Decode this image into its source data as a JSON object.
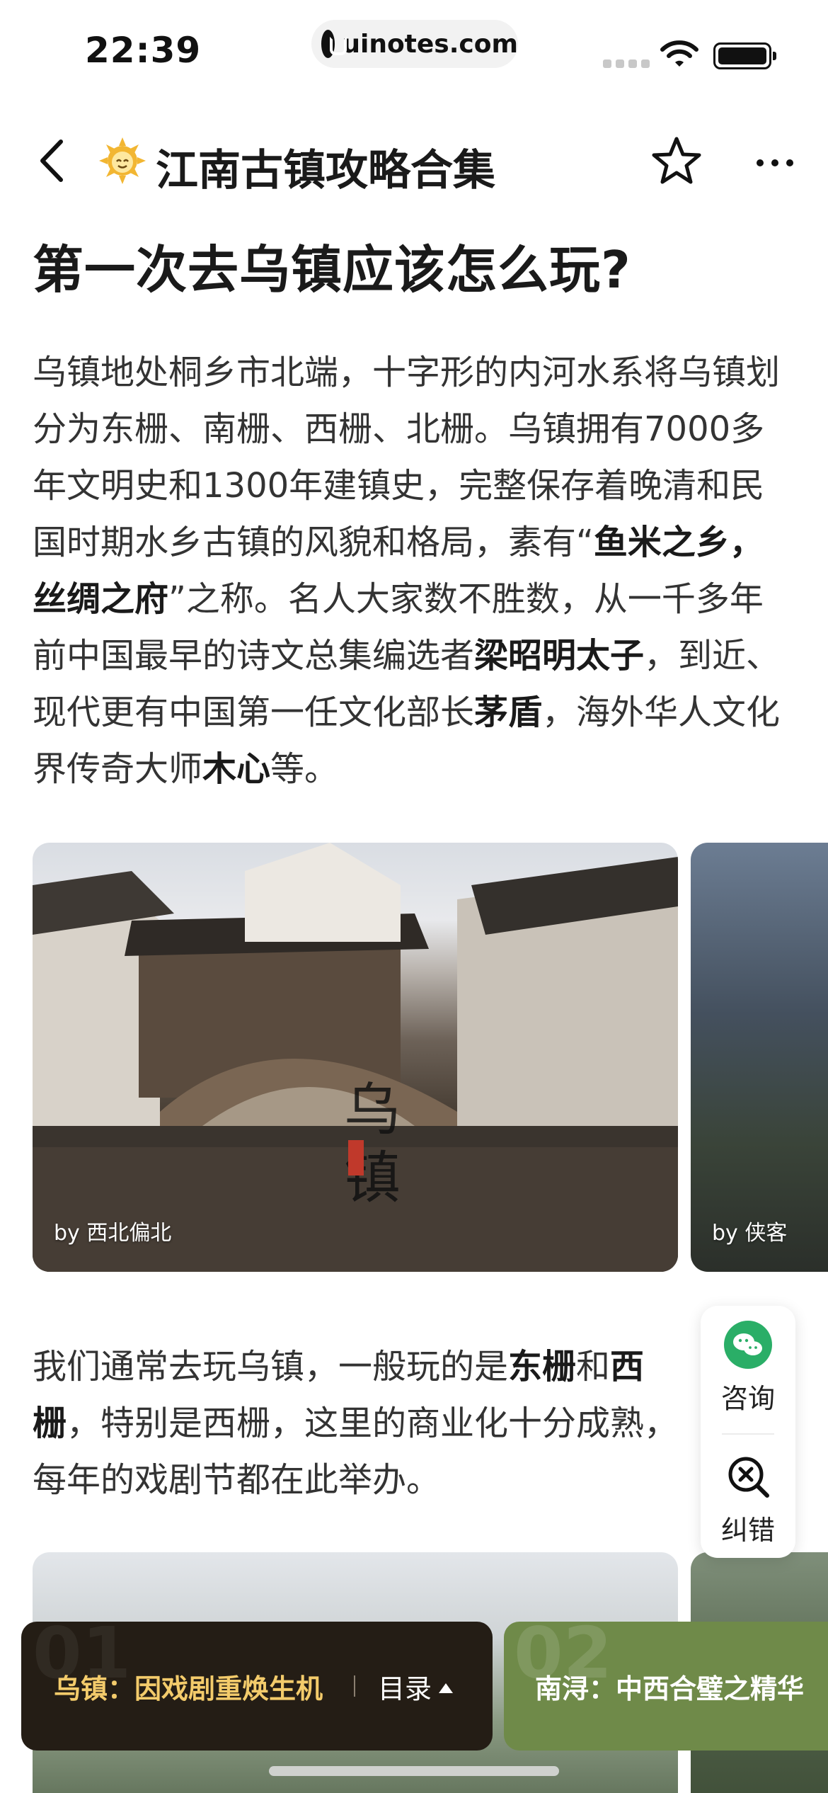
{
  "status_bar": {
    "time": "22:39",
    "url": "uinotes.com"
  },
  "nav": {
    "title": "江南古镇攻略合集",
    "icons": [
      "back-icon",
      "sun-mascot-icon",
      "star-icon",
      "more-icon"
    ]
  },
  "article": {
    "title": "第一次去乌镇应该怎么玩?",
    "para1": [
      {
        "t": "乌镇地处桐乡市北端，十字形的内河水系将乌镇划分为东栅、南栅、西栅、北栅。乌镇拥有7000多年文明史和1300年建镇史，完整保存着晚清和民国时期水乡古镇的风貌和格局，素有“",
        "b": false
      },
      {
        "t": "鱼米之乡，丝绸之府",
        "b": true
      },
      {
        "t": "”之称。名人大家数不胜数，从一千多年前中国最早的诗文总集编选者",
        "b": false
      },
      {
        "t": "梁昭明太子",
        "b": true
      },
      {
        "t": "，到近、现代更有中国第一任文化部长",
        "b": false
      },
      {
        "t": "茅盾",
        "b": true
      },
      {
        "t": "，海外华人文化界传奇大师",
        "b": false
      },
      {
        "t": "木心",
        "b": true
      },
      {
        "t": "等。",
        "b": false
      }
    ],
    "para2": [
      {
        "t": "我们通常去玩乌镇，一般玩的是",
        "b": false
      },
      {
        "t": "东栅",
        "b": true
      },
      {
        "t": "和",
        "b": false
      },
      {
        "t": "西栅",
        "b": true
      },
      {
        "t": "，特别是西栅，这里的商业化十分成熟，每年的戏剧节都在此举办。",
        "b": false
      }
    ]
  },
  "photos": [
    {
      "credit": "by 西北偏北",
      "mark": "乌镇"
    },
    {
      "credit": "by 侠客"
    }
  ],
  "float_tool": {
    "consult_label": "咨询",
    "correct_label": "纠错"
  },
  "chapters": {
    "current_num": "01",
    "current_title": "乌镇：因戏剧重焕生机",
    "toc_label": "目录",
    "next_num": "02",
    "next_title": "南浔：中西合璧之精华"
  },
  "colors": {
    "chapter_bg": "#241d15",
    "chapter_title": "#f3cb6b",
    "chapter_next_bg": "#6f8a49",
    "wechat_green": "#2aae67"
  }
}
